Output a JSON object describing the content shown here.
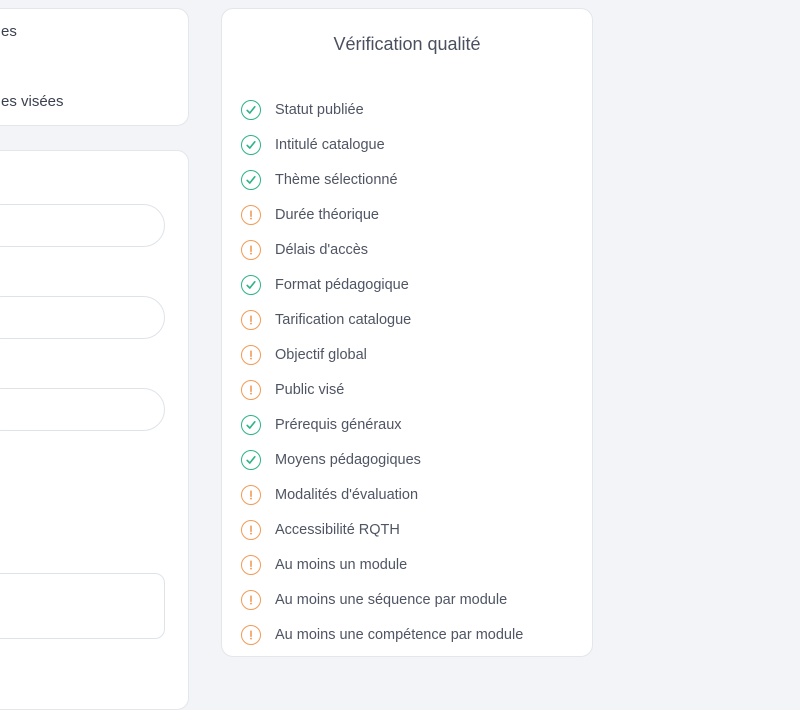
{
  "colors": {
    "ok": "#2cb389",
    "warning": "#f29b56"
  },
  "left_panel": {
    "top_card": {
      "line1": "es",
      "line2": "es visées"
    }
  },
  "quality": {
    "title": "Vérification qualité",
    "items": [
      {
        "label": "Statut publiée",
        "status": "ok",
        "icon": "check-circle-icon"
      },
      {
        "label": "Intitulé catalogue",
        "status": "ok",
        "icon": "check-circle-icon"
      },
      {
        "label": "Thème sélectionné",
        "status": "ok",
        "icon": "check-circle-icon"
      },
      {
        "label": "Durée théorique",
        "status": "warning",
        "icon": "warning-circle-icon"
      },
      {
        "label": "Délais d'accès",
        "status": "warning",
        "icon": "warning-circle-icon"
      },
      {
        "label": "Format pédagogique",
        "status": "ok",
        "icon": "check-circle-icon"
      },
      {
        "label": "Tarification catalogue",
        "status": "warning",
        "icon": "warning-circle-icon"
      },
      {
        "label": "Objectif global",
        "status": "warning",
        "icon": "warning-circle-icon"
      },
      {
        "label": "Public visé",
        "status": "warning",
        "icon": "warning-circle-icon"
      },
      {
        "label": "Prérequis généraux",
        "status": "ok",
        "icon": "check-circle-icon"
      },
      {
        "label": "Moyens pédagogiques",
        "status": "ok",
        "icon": "check-circle-icon"
      },
      {
        "label": "Modalités d'évaluation",
        "status": "warning",
        "icon": "warning-circle-icon"
      },
      {
        "label": "Accessibilité RQTH",
        "status": "warning",
        "icon": "warning-circle-icon"
      },
      {
        "label": "Au moins un module",
        "status": "warning",
        "icon": "warning-circle-icon"
      },
      {
        "label": "Au moins une séquence par module",
        "status": "warning",
        "icon": "warning-circle-icon"
      },
      {
        "label": "Au moins une compétence par module",
        "status": "warning",
        "icon": "warning-circle-icon"
      }
    ]
  }
}
